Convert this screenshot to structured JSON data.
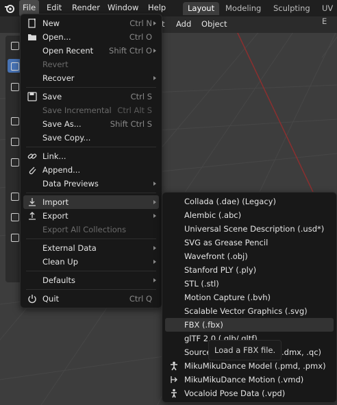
{
  "topbar": {
    "menus": [
      "File",
      "Edit",
      "Render",
      "Window",
      "Help"
    ],
    "workspaces": [
      "Layout",
      "Modeling",
      "Sculpting",
      "UV E"
    ]
  },
  "viewport_header": {
    "menus": [
      "t",
      "Add",
      "Object"
    ]
  },
  "file_menu": {
    "items": [
      {
        "label": "New",
        "shortcut": "Ctrl N",
        "arrow": true,
        "icon": "new-file-icon"
      },
      {
        "label": "Open...",
        "shortcut": "Ctrl O",
        "icon": "folder-icon"
      },
      {
        "label": "Open Recent",
        "shortcut": "Shift Ctrl O",
        "arrow": true
      },
      {
        "label": "Revert",
        "disabled": true
      },
      {
        "label": "Recover",
        "arrow": true
      },
      {
        "label": "Save",
        "shortcut": "Ctrl S",
        "icon": "save-icon"
      },
      {
        "label": "Save Incremental",
        "shortcut": "Ctrl Alt S",
        "disabled": true
      },
      {
        "label": "Save As...",
        "shortcut": "Shift Ctrl S"
      },
      {
        "label": "Save Copy..."
      },
      {
        "label": "Link...",
        "icon": "link-icon"
      },
      {
        "label": "Append...",
        "icon": "append-icon"
      },
      {
        "label": "Data Previews",
        "arrow": true
      },
      {
        "label": "Import",
        "arrow": true,
        "icon": "import-icon",
        "highlight": true
      },
      {
        "label": "Export",
        "arrow": true,
        "icon": "export-icon"
      },
      {
        "label": "Export All Collections",
        "disabled": true
      },
      {
        "label": "External Data",
        "arrow": true
      },
      {
        "label": "Clean Up",
        "arrow": true
      },
      {
        "label": "Defaults",
        "arrow": true
      },
      {
        "label": "Quit",
        "shortcut": "Ctrl Q",
        "icon": "power-icon"
      }
    ]
  },
  "import_menu": {
    "items": [
      {
        "label": "Collada (.dae) (Legacy)"
      },
      {
        "label": "Alembic (.abc)"
      },
      {
        "label": "Universal Scene Description (.usd*)"
      },
      {
        "label": "SVG as Grease Pencil"
      },
      {
        "label": "Wavefront (.obj)"
      },
      {
        "label": "Stanford PLY (.ply)"
      },
      {
        "label": "STL (.stl)"
      },
      {
        "label": "Motion Capture (.bvh)"
      },
      {
        "label": "Scalable Vector Graphics (.svg)"
      },
      {
        "label": "FBX (.fbx)",
        "highlight": true
      },
      {
        "label": "glTF 2.0 (.glb/.gltf)"
      },
      {
        "label": "Source",
        "suffix": ".dmx, .qc)"
      },
      {
        "label": "MikuMikuDance Model (.pmd, .pmx)",
        "icon": "figure-icon"
      },
      {
        "label": "MikuMikuDance Motion (.vmd)",
        "icon": "motion-icon"
      },
      {
        "label": "Vocaloid Pose Data (.vpd)",
        "icon": "pose-icon"
      }
    ]
  },
  "tooltip": {
    "text": "Load a FBX file."
  },
  "colors": {
    "accent": "#4772b3",
    "menu_bg": "#181818",
    "highlight": "#333333",
    "grid": "#4a4a4a",
    "axis_red": "#8b2f2f"
  }
}
